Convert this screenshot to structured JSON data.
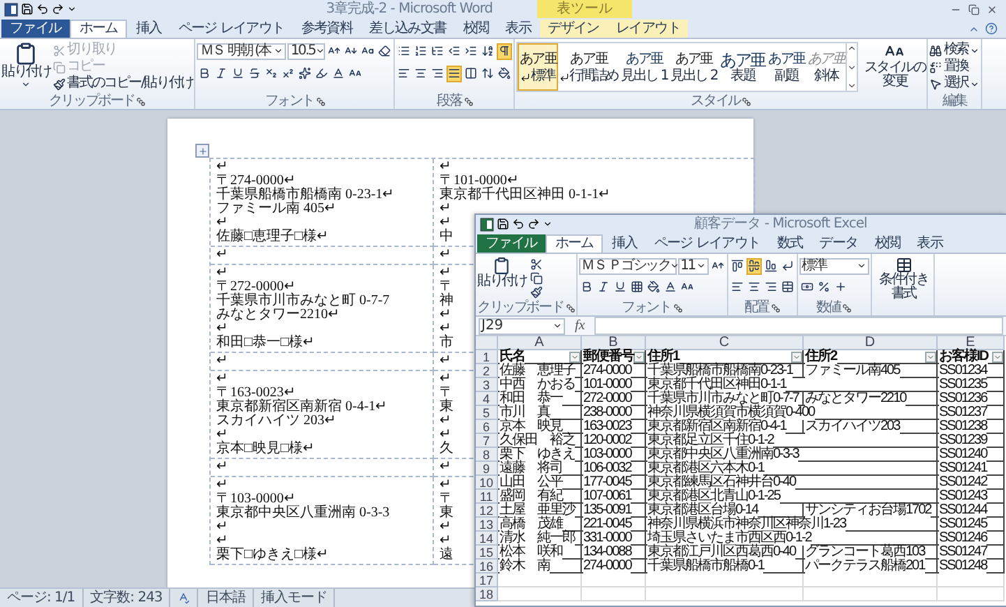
{
  "word": {
    "title": "3章完成-2 - Microsoft Word",
    "context_header": "表ツール",
    "tabs": [
      {
        "label": "ファイル",
        "kind": "file",
        "selected": false
      },
      {
        "label": "ホーム",
        "kind": "normal",
        "selected": true
      },
      {
        "label": "挿入",
        "kind": "normal",
        "selected": false
      },
      {
        "label": "ページ レイアウト",
        "kind": "normal",
        "selected": false
      },
      {
        "label": "参考資料",
        "kind": "normal",
        "selected": false
      },
      {
        "label": "差し込み文書",
        "kind": "normal",
        "selected": false
      },
      {
        "label": "校閲",
        "kind": "normal",
        "selected": false
      },
      {
        "label": "表示",
        "kind": "normal",
        "selected": false
      },
      {
        "label": "デザイン",
        "kind": "contextual",
        "selected": false
      },
      {
        "label": "レイアウト",
        "kind": "contextual",
        "selected": false
      }
    ],
    "ribbon": {
      "clipboard": {
        "label": "クリップボード",
        "paste": "貼り付け",
        "items": [
          {
            "label": "切り取り",
            "disabled": true
          },
          {
            "label": "コピー",
            "disabled": true
          },
          {
            "label": "書式のコピー/貼り付け",
            "disabled": false
          }
        ]
      },
      "font": {
        "label": "フォント",
        "face": "ＭＳ 明朝 (本",
        "size": "10.5"
      },
      "paragraph": {
        "label": "段落",
        "show_marks": true,
        "alignments": [
          {
            "selected": false
          },
          {
            "selected": false
          },
          {
            "selected": false
          },
          {
            "selected": true
          },
          {
            "selected": false
          }
        ]
      },
      "styles": {
        "label": "スタイル",
        "change": "スタイルの変更",
        "items": [
          {
            "preview": "あア亜",
            "label": "標準",
            "kind": "body",
            "mark": true,
            "selected": true
          },
          {
            "preview": "あア亜",
            "label": "行間詰め",
            "kind": "body",
            "mark": true,
            "selected": false
          },
          {
            "preview": "あア亜",
            "label": "見出し 1",
            "kind": "heading",
            "mark": false,
            "selected": false
          },
          {
            "preview": "あア亜",
            "label": "見出し 2",
            "kind": "body",
            "mark": false,
            "selected": false
          },
          {
            "preview": "あア亜",
            "label": "表題",
            "kind": "title",
            "mark": false,
            "selected": false
          },
          {
            "preview": "あア亜",
            "label": "副題",
            "kind": "heading",
            "mark": false,
            "selected": false
          },
          {
            "preview": "あア亜",
            "label": "斜体",
            "kind": "subtle",
            "mark": false,
            "selected": false
          }
        ]
      },
      "editing": {
        "label": "編集",
        "items": [
          {
            "label": "検索",
            "dropdown": true
          },
          {
            "label": "置換",
            "dropdown": false
          },
          {
            "label": "選択",
            "dropdown": true
          }
        ]
      }
    },
    "document": {
      "rows": [
        [
          [
            "↵",
            "〒274-0000↵",
            "千葉県船橋市船橋南 0-23-1↵",
            "ファミール南 405↵",
            "↵",
            "佐藤□恵理子□様↵"
          ],
          [
            "↵",
            "〒101-0000↵",
            "東京都千代田区神田 0-1-1↵",
            "↵",
            "↵",
            "中"
          ]
        ],
        [
          [
            "↵"
          ],
          [
            "↵"
          ]
        ],
        [
          [
            "↵",
            "〒272-0000↵",
            "千葉県市川市みなと町 0-7-7",
            "みなとタワー2210↵",
            "↵",
            "和田□恭一□様↵"
          ],
          [
            "↵",
            "〒",
            "神",
            "↵",
            "↵",
            "市"
          ]
        ],
        [
          [
            "↵"
          ],
          [
            "↵"
          ]
        ],
        [
          [
            "↵",
            "〒163-0023↵",
            "東京都新宿区南新宿 0-4-1↵",
            "スカイハイツ 203↵",
            "↵",
            "京本□映見□様↵"
          ],
          [
            "↵",
            "〒",
            "東",
            "↵",
            "↵",
            "久"
          ]
        ],
        [
          [
            "↵"
          ],
          [
            "↵"
          ]
        ],
        [
          [
            "↵",
            "〒103-0000↵",
            "東京都中央区八重洲南 0-3-3",
            "↵",
            "↵",
            "栗下□ゆきえ□様↵"
          ],
          [
            "↵",
            "〒",
            "東",
            "↵",
            "↵",
            "遠"
          ]
        ]
      ]
    },
    "status_bar": {
      "page": "ページ: 1/1",
      "words": "文字数: 243",
      "language": "日本語",
      "mode": "挿入モード"
    }
  },
  "excel": {
    "title": "顧客データ - Microsoft Excel",
    "tabs": [
      {
        "label": "ファイル",
        "kind": "file",
        "selected": false
      },
      {
        "label": "ホーム",
        "kind": "normal",
        "selected": true
      },
      {
        "label": "挿入",
        "kind": "normal",
        "selected": false
      },
      {
        "label": "ページ レイアウト",
        "kind": "normal",
        "selected": false
      },
      {
        "label": "数式",
        "kind": "normal",
        "selected": false
      },
      {
        "label": "データ",
        "kind": "normal",
        "selected": false
      },
      {
        "label": "校閲",
        "kind": "normal",
        "selected": false
      },
      {
        "label": "表示",
        "kind": "normal",
        "selected": false
      }
    ],
    "ribbon": {
      "clipboard": {
        "label": "クリップボード",
        "paste": "貼り付け"
      },
      "font": {
        "label": "フォント",
        "face": "ＭＳ Ｐゴシック",
        "size": "11"
      },
      "alignment": {
        "label": "配置",
        "vertical": [
          {
            "selected": false
          },
          {
            "selected": true
          },
          {
            "selected": false
          }
        ]
      },
      "number": {
        "label": "数値",
        "format": "標準"
      },
      "conditional": "条件付き書式"
    },
    "sheet": {
      "name_box": "J29",
      "function_label": "fx",
      "columns": [
        "A",
        "B",
        "C",
        "D",
        "E"
      ],
      "row_numbers": [
        "1",
        "2",
        "3",
        "4",
        "5",
        "6",
        "7",
        "8",
        "9",
        "10",
        "11",
        "12",
        "13",
        "14",
        "15",
        "16",
        "17",
        "18"
      ],
      "headers": [
        "氏名",
        "郵便番号",
        "住所1",
        "住所2",
        "お客様ID"
      ],
      "rows": [
        [
          "佐藤　恵理子",
          "274-0000",
          "千葉県船橋市船橋南0-23-1",
          "ファミール南405",
          "SS01234"
        ],
        [
          "中西　かおる",
          "101-0000",
          "東京都千代田区神田0-1-1",
          null,
          "SS01235"
        ],
        [
          "和田　恭一",
          "272-0000",
          "千葉県市川市みなと町0-7-7",
          "みなとタワー2210",
          "SS01236"
        ],
        [
          "市川　真",
          "238-0000",
          "神奈川県横須賀市横須賀0-400",
          null,
          "SS01237"
        ],
        [
          "京本　映見",
          "163-0023",
          "東京都新宿区南新宿0-4-1",
          "スカイハイツ203",
          "SS01238"
        ],
        [
          "久保田　裕之",
          "120-0002",
          "東京都足立区千住0-1-2",
          null,
          "SS01239"
        ],
        [
          "栗下　ゆきえ",
          "103-0000",
          "東京都中央区八重洲南0-3-3",
          null,
          "SS01240"
        ],
        [
          "遠藤　将司",
          "106-0032",
          "東京都港区六本木0-1",
          null,
          "SS01241"
        ],
        [
          "山田　公平",
          "177-0045",
          "東京都練馬区石神井台0-40",
          null,
          "SS01242"
        ],
        [
          "盛岡　有紀",
          "107-0061",
          "東京都港区北青山0-1-25",
          null,
          "SS01243"
        ],
        [
          "土屋　亜里沙",
          "135-0091",
          "東京都港区台場0-14",
          "サンシティお台場1702",
          "SS01244"
        ],
        [
          "高橋　茂雄",
          "221-0045",
          "神奈川県横浜市神奈川区神奈川1-23",
          null,
          "SS01245"
        ],
        [
          "清水　純一郎",
          "331-0000",
          "埼玉県さいたま市西区西0-1-2",
          null,
          "SS01246"
        ],
        [
          "松本　咲和",
          "134-0088",
          "東京都江戸川区西葛西0-40",
          "グランコート葛西103",
          "SS01247"
        ],
        [
          "鈴木　南",
          "274-0000",
          "千葉県船橋市船橋0-1",
          "パークテラス船橋201",
          "SS01248"
        ]
      ]
    }
  }
}
